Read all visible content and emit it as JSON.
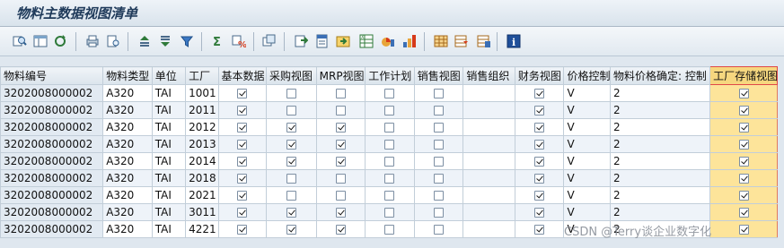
{
  "window": {
    "title": "物料主数据视图清单"
  },
  "toolbar": {
    "buttons": [
      {
        "icon": "details-icon"
      },
      {
        "icon": "select-layout-icon"
      },
      {
        "icon": "refresh-icon"
      },
      {
        "icon": "print-icon"
      },
      {
        "icon": "print-preview-icon"
      },
      {
        "icon": "sort-ascending-icon"
      },
      {
        "icon": "sort-descending-icon"
      },
      {
        "icon": "filter-icon"
      },
      {
        "icon": "sum-icon"
      },
      {
        "icon": "subtotal-icon"
      },
      {
        "icon": "views-icon"
      },
      {
        "icon": "export-icon"
      },
      {
        "icon": "word-processing-icon"
      },
      {
        "icon": "local-file-icon"
      },
      {
        "icon": "spreadsheet-icon"
      },
      {
        "icon": "graphic-icon"
      },
      {
        "icon": "abc-analysis-icon"
      },
      {
        "icon": "change-layout-icon"
      },
      {
        "icon": "choose-layout-icon"
      },
      {
        "icon": "save-layout-icon"
      },
      {
        "icon": "info-icon"
      }
    ]
  },
  "grid": {
    "columns": [
      "物料编号",
      "物料类型",
      "单位",
      "工厂",
      "基本数据",
      "采购视图",
      "MRP视图",
      "工作计划",
      "销售视图",
      "销售组织",
      "财务视图",
      "价格控制",
      "物料价格确定: 控制",
      "工厂存储视图"
    ],
    "rows": [
      {
        "material": "3202008000002",
        "type": "A320",
        "unit": "TAI",
        "plant": "1001",
        "basic": true,
        "purchasing": false,
        "mrp": false,
        "work_plan": false,
        "sales": false,
        "sales_org": "",
        "finance": true,
        "price_control": "V",
        "price_det": "2",
        "plant_storage": true
      },
      {
        "material": "3202008000002",
        "type": "A320",
        "unit": "TAI",
        "plant": "2011",
        "basic": true,
        "purchasing": false,
        "mrp": false,
        "work_plan": false,
        "sales": false,
        "sales_org": "",
        "finance": true,
        "price_control": "V",
        "price_det": "2",
        "plant_storage": true
      },
      {
        "material": "3202008000002",
        "type": "A320",
        "unit": "TAI",
        "plant": "2012",
        "basic": true,
        "purchasing": true,
        "mrp": true,
        "work_plan": false,
        "sales": false,
        "sales_org": "",
        "finance": true,
        "price_control": "V",
        "price_det": "2",
        "plant_storage": true
      },
      {
        "material": "3202008000002",
        "type": "A320",
        "unit": "TAI",
        "plant": "2013",
        "basic": true,
        "purchasing": true,
        "mrp": true,
        "work_plan": false,
        "sales": false,
        "sales_org": "",
        "finance": true,
        "price_control": "V",
        "price_det": "2",
        "plant_storage": true
      },
      {
        "material": "3202008000002",
        "type": "A320",
        "unit": "TAI",
        "plant": "2014",
        "basic": true,
        "purchasing": true,
        "mrp": true,
        "work_plan": false,
        "sales": false,
        "sales_org": "",
        "finance": true,
        "price_control": "V",
        "price_det": "2",
        "plant_storage": true
      },
      {
        "material": "3202008000002",
        "type": "A320",
        "unit": "TAI",
        "plant": "2018",
        "basic": true,
        "purchasing": false,
        "mrp": false,
        "work_plan": false,
        "sales": false,
        "sales_org": "",
        "finance": true,
        "price_control": "V",
        "price_det": "2",
        "plant_storage": true
      },
      {
        "material": "3202008000002",
        "type": "A320",
        "unit": "TAI",
        "plant": "2021",
        "basic": true,
        "purchasing": false,
        "mrp": false,
        "work_plan": false,
        "sales": false,
        "sales_org": "",
        "finance": true,
        "price_control": "V",
        "price_det": "2",
        "plant_storage": true
      },
      {
        "material": "3202008000002",
        "type": "A320",
        "unit": "TAI",
        "plant": "3011",
        "basic": true,
        "purchasing": true,
        "mrp": true,
        "work_plan": false,
        "sales": false,
        "sales_org": "",
        "finance": true,
        "price_control": "V",
        "price_det": "2",
        "plant_storage": true
      },
      {
        "material": "3202008000002",
        "type": "A320",
        "unit": "TAI",
        "plant": "4221",
        "basic": true,
        "purchasing": true,
        "mrp": true,
        "work_plan": false,
        "sales": false,
        "sales_org": "",
        "finance": true,
        "price_control": "V",
        "price_det": "2",
        "plant_storage": true
      }
    ]
  },
  "watermark": "CSDN @Terry谈企业数字化"
}
